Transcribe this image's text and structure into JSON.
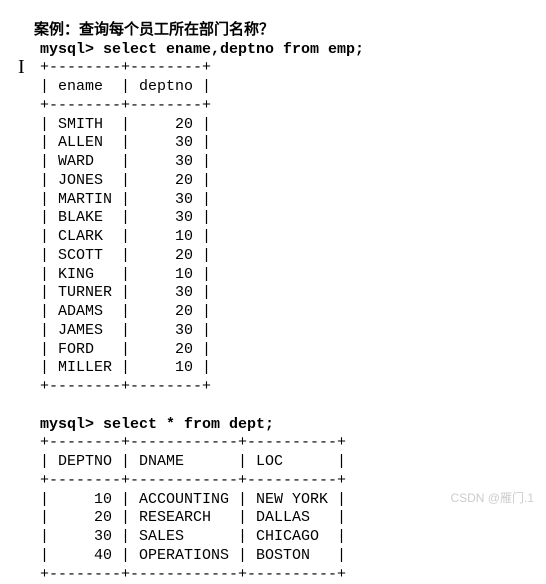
{
  "title": "案例：查询每个员工所在部门名称？",
  "prompt": "mysql>",
  "query1": " select ename,deptno from emp;",
  "table1": {
    "border": "+--------+--------+",
    "header": "| ename  | deptno |",
    "rows": [
      "| SMITH  |     20 |",
      "| ALLEN  |     30 |",
      "| WARD   |     30 |",
      "| JONES  |     20 |",
      "| MARTIN |     30 |",
      "| BLAKE  |     30 |",
      "| CLARK  |     10 |",
      "| SCOTT  |     20 |",
      "| KING   |     10 |",
      "| TURNER |     30 |",
      "| ADAMS  |     20 |",
      "| JAMES  |     30 |",
      "| FORD   |     20 |",
      "| MILLER |     10 |"
    ]
  },
  "query2": " select * from dept;",
  "table2": {
    "border": "+--------+------------+----------+",
    "header": "| DEPTNO | DNAME      | LOC      |",
    "rows": [
      "|     10 | ACCOUNTING | NEW YORK |",
      "|     20 | RESEARCH   | DALLAS   |",
      "|     30 | SALES      | CHICAGO  |",
      "|     40 | OPERATIONS | BOSTON   |"
    ]
  },
  "watermark": "CSDN @雁门.1",
  "cursor": "I",
  "chart_data": [
    {
      "type": "table",
      "title": "emp",
      "columns": [
        "ename",
        "deptno"
      ],
      "rows": [
        [
          "SMITH",
          20
        ],
        [
          "ALLEN",
          30
        ],
        [
          "WARD",
          30
        ],
        [
          "JONES",
          20
        ],
        [
          "MARTIN",
          30
        ],
        [
          "BLAKE",
          30
        ],
        [
          "CLARK",
          10
        ],
        [
          "SCOTT",
          20
        ],
        [
          "KING",
          10
        ],
        [
          "TURNER",
          30
        ],
        [
          "ADAMS",
          20
        ],
        [
          "JAMES",
          30
        ],
        [
          "FORD",
          20
        ],
        [
          "MILLER",
          10
        ]
      ]
    },
    {
      "type": "table",
      "title": "dept",
      "columns": [
        "DEPTNO",
        "DNAME",
        "LOC"
      ],
      "rows": [
        [
          10,
          "ACCOUNTING",
          "NEW YORK"
        ],
        [
          20,
          "RESEARCH",
          "DALLAS"
        ],
        [
          30,
          "SALES",
          "CHICAGO"
        ],
        [
          40,
          "OPERATIONS",
          "BOSTON"
        ]
      ]
    }
  ]
}
